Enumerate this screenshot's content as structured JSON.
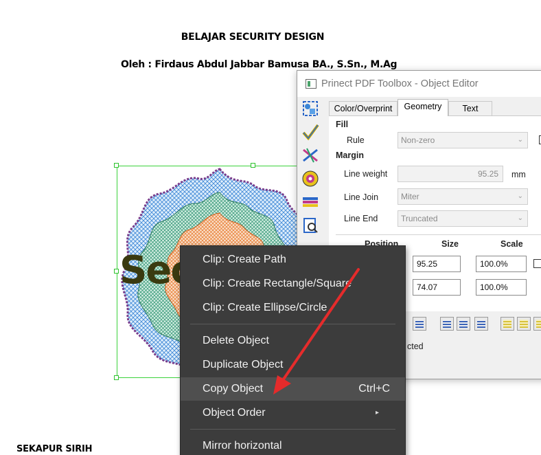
{
  "document": {
    "title": "BELAJAR SECURITY DESIGN",
    "author": "Oleh : Firdaus Abdul Jabbar Bamusa BA., S.Sn., M.Ag",
    "section": "SEKAPUR SIRIH",
    "art_text": "Sec"
  },
  "editor": {
    "window_title": "Prinect PDF Toolbox - Object Editor",
    "tools": [
      "object-select-icon",
      "preflight-check-icon",
      "transform-icon",
      "color-icon",
      "separation-icon",
      "inspect-icon"
    ],
    "tabs": [
      "Color/Overprint",
      "Geometry",
      "Text"
    ],
    "active_tab": "Geometry",
    "fill": {
      "heading": "Fill",
      "rule_label": "Rule",
      "rule_value": "Non-zero"
    },
    "margin": {
      "heading": "Margin",
      "line_weight_label": "Line weight",
      "line_weight_value": "95.25",
      "line_weight_unit": "mm",
      "line_join_label": "Line Join",
      "line_join_value": "Miter",
      "line_end_label": "Line End",
      "line_end_value": "Truncated"
    },
    "columns": {
      "position": "Position",
      "size": "Size",
      "scale": "Scale"
    },
    "rows": [
      {
        "size": "95.25",
        "scale": "100.0%"
      },
      {
        "size": "74.07",
        "scale": "100.0%"
      }
    ],
    "status_text": "cted"
  },
  "context_menu": {
    "items": [
      {
        "label": "Clip: Create Path"
      },
      {
        "label": "Clip: Create Rectangle/Square"
      },
      {
        "label": "Clip: Create Ellipse/Circle"
      },
      {
        "label": "Delete Object"
      },
      {
        "label": "Duplicate Object"
      },
      {
        "label": "Copy Object",
        "shortcut": "Ctrl+C"
      },
      {
        "label": "Object Order"
      },
      {
        "label": "Mirror horizontal"
      }
    ],
    "highlighted": "Copy Object",
    "submenu_arrow": "▸"
  },
  "colors": {
    "menu_bg": "#3c3c3c",
    "menu_highlight": "#4f4f4f",
    "selection": "#3ad23a",
    "annotation_arrow": "#e52b2b"
  }
}
